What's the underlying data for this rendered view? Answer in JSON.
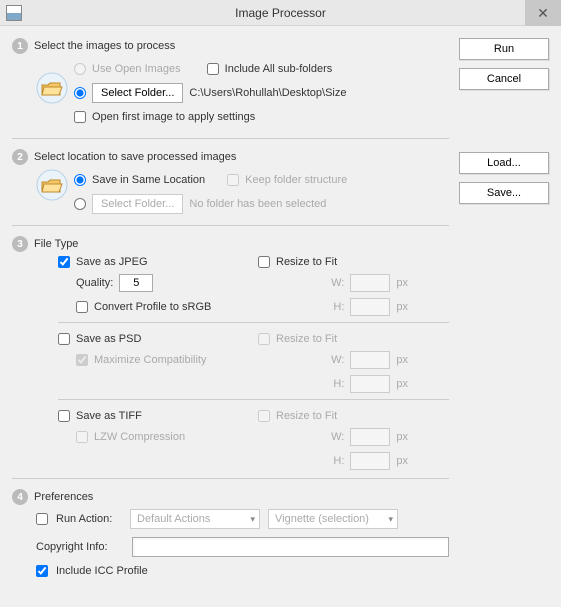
{
  "window": {
    "title": "Image Processor"
  },
  "buttons": {
    "run": "Run",
    "cancel": "Cancel",
    "load": "Load...",
    "save": "Save..."
  },
  "section1": {
    "title": "Select the images to process",
    "use_open_images": "Use Open Images",
    "include_subfolders": "Include All sub-folders",
    "select_folder_btn": "Select Folder...",
    "path": "C:\\Users\\Rohullah\\Desktop\\Size",
    "open_first": "Open first image to apply settings"
  },
  "section2": {
    "title": "Select location to save processed images",
    "save_same": "Save in Same Location",
    "keep_structure": "Keep folder structure",
    "select_folder_btn": "Select Folder...",
    "no_folder": "No folder has been selected"
  },
  "section3": {
    "title": "File Type",
    "save_jpeg": "Save as JPEG",
    "resize_fit": "Resize to Fit",
    "quality_label": "Quality:",
    "quality_value": "5",
    "w_label": "W:",
    "h_label": "H:",
    "px": "px",
    "convert_srgb": "Convert Profile to sRGB",
    "save_psd": "Save as PSD",
    "max_compat": "Maximize Compatibility",
    "save_tiff": "Save as TIFF",
    "lzw": "LZW Compression"
  },
  "section4": {
    "title": "Preferences",
    "run_action": "Run Action:",
    "action_set": "Default Actions",
    "action_name": "Vignette (selection)",
    "copyright_label": "Copyright Info:",
    "copyright_value": "",
    "include_icc": "Include ICC Profile"
  }
}
